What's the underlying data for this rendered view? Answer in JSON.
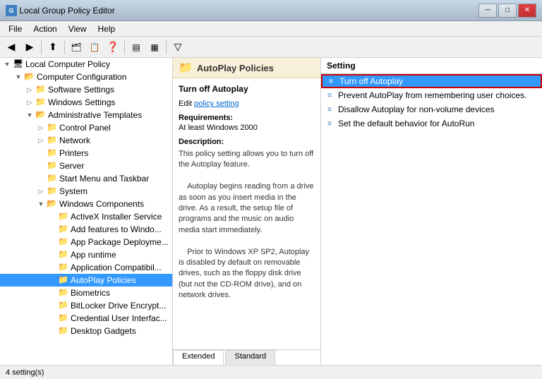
{
  "window": {
    "title": "Local Group Policy Editor",
    "icon": "📋"
  },
  "titlebar": {
    "minimize": "─",
    "maximize": "□",
    "close": "✕"
  },
  "menubar": {
    "items": [
      "File",
      "Action",
      "View",
      "Help"
    ]
  },
  "toolbar": {
    "buttons": [
      "◀",
      "▶",
      "⬆",
      "🗂",
      "📋",
      "❓",
      "📄",
      "🔲",
      "▼"
    ]
  },
  "tree": {
    "root_label": "Local Computer Policy",
    "items": [
      {
        "id": "local-computer-policy",
        "label": "Local Computer Policy",
        "level": 0,
        "expanded": true,
        "icon": "computer"
      },
      {
        "id": "computer-configuration",
        "label": "Computer Configuration",
        "level": 1,
        "expanded": true,
        "icon": "folder-open"
      },
      {
        "id": "software-settings",
        "label": "Software Settings",
        "level": 2,
        "expanded": false,
        "icon": "folder"
      },
      {
        "id": "windows-settings",
        "label": "Windows Settings",
        "level": 2,
        "expanded": false,
        "icon": "folder"
      },
      {
        "id": "administrative-templates",
        "label": "Administrative Templates",
        "level": 2,
        "expanded": true,
        "icon": "folder-open"
      },
      {
        "id": "control-panel",
        "label": "Control Panel",
        "level": 3,
        "expanded": false,
        "icon": "folder"
      },
      {
        "id": "network",
        "label": "Network",
        "level": 3,
        "expanded": false,
        "icon": "folder"
      },
      {
        "id": "printers",
        "label": "Printers",
        "level": 3,
        "expanded": false,
        "icon": "folder"
      },
      {
        "id": "server",
        "label": "Server",
        "level": 3,
        "expanded": false,
        "icon": "folder"
      },
      {
        "id": "start-menu-taskbar",
        "label": "Start Menu and Taskbar",
        "level": 3,
        "expanded": false,
        "icon": "folder"
      },
      {
        "id": "system",
        "label": "System",
        "level": 3,
        "expanded": false,
        "icon": "folder"
      },
      {
        "id": "windows-components",
        "label": "Windows Components",
        "level": 3,
        "expanded": true,
        "icon": "folder-open"
      },
      {
        "id": "activex",
        "label": "ActiveX Installer Service",
        "level": 4,
        "expanded": false,
        "icon": "folder"
      },
      {
        "id": "add-features",
        "label": "Add features to Windo...",
        "level": 4,
        "expanded": false,
        "icon": "folder"
      },
      {
        "id": "app-package",
        "label": "App Package Deployme...",
        "level": 4,
        "expanded": false,
        "icon": "folder"
      },
      {
        "id": "app-runtime",
        "label": "App runtime",
        "level": 4,
        "expanded": false,
        "icon": "folder"
      },
      {
        "id": "app-compat",
        "label": "Application Compatibil...",
        "level": 4,
        "expanded": false,
        "icon": "folder"
      },
      {
        "id": "autoplay",
        "label": "AutoPlay Policies",
        "level": 4,
        "expanded": false,
        "icon": "folder",
        "selected": true
      },
      {
        "id": "biometrics",
        "label": "Biometrics",
        "level": 4,
        "expanded": false,
        "icon": "folder"
      },
      {
        "id": "bitlocker",
        "label": "BitLocker Drive Encrypt...",
        "level": 4,
        "expanded": false,
        "icon": "folder"
      },
      {
        "id": "credential-ui",
        "label": "Credential User Interfac...",
        "level": 4,
        "expanded": false,
        "icon": "folder"
      },
      {
        "id": "desktop-gadgets",
        "label": "Desktop Gadgets",
        "level": 4,
        "expanded": false,
        "icon": "folder"
      }
    ]
  },
  "middle": {
    "header": "AutoPlay Policies",
    "policy_name": "Turn off Autoplay",
    "edit_label": "Edit",
    "policy_setting": "policy setting",
    "requirements_label": "Requirements:",
    "requirements_value": "At least Windows 2000",
    "description_label": "Description:",
    "description_text": "This policy setting allows you to turn off the Autoplay feature.\n\nAutoplay begins reading from a drive as soon as you insert media in the drive. As a result, the setup file of programs and the music on audio media start immediately.\n\nPrior to Windows XP SP2, Autoplay is disabled by default on removable drives, such as the floppy disk drive (but not the CD-ROM drive), and on network drives.",
    "tabs": [
      "Extended",
      "Standard"
    ]
  },
  "right_panel": {
    "header": "Setting",
    "items": [
      {
        "id": "turn-off-autoplay",
        "label": "Turn off Autoplay",
        "selected": true
      },
      {
        "id": "prevent-autoplay-remembering",
        "label": "Prevent AutoPlay from remembering user choices."
      },
      {
        "id": "disallow-autoplay-nonvolume",
        "label": "Disallow Autoplay for non-volume devices"
      },
      {
        "id": "set-default-behavior",
        "label": "Set the default behavior for AutoRun"
      }
    ]
  },
  "statusbar": {
    "text": "4 setting(s)"
  }
}
